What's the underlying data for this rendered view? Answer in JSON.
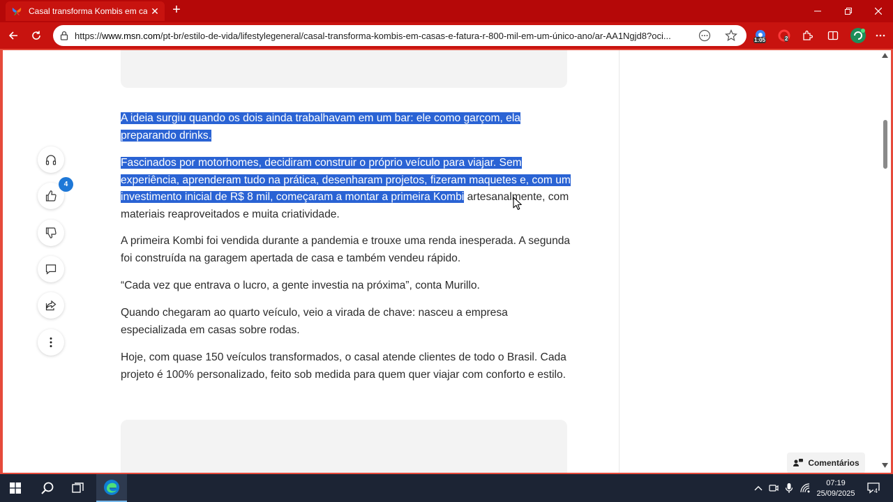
{
  "browser": {
    "tab_title": "Casal transforma Kombis em casas",
    "url_prefix": "https://",
    "url_domain": "www.msn.com",
    "url_path": "/pt-br/estilo-de-vida/lifestylegeneral/casal-transforma-kombis-em-casas-e-fatura-r-800-mil-em-um-único-ano/ar-AA1Ngjd8?oci...",
    "extension_badge_1": "1:05",
    "extension_badge_2": "2",
    "accent_color": "#c8130f"
  },
  "article": {
    "paragraphs": {
      "p1": "A ideia surgiu quando os dois ainda trabalhavam em um bar: ele como garçom, ela preparando drinks.",
      "p2_selected": "Fascinados por motorhomes, decidiram construir o próprio veículo para viajar. Sem experiência, aprenderam tudo na prática, desenharam projetos, fizeram maquetes e, com um investimento inicial de R$ 8 mil, começaram a montar a primeira Kombi",
      "p2_rest": "artesanalmente, com materiais reaproveitados e muita criatividade.",
      "p3": "A primeira Kombi foi vendida durante a pandemia e trouxe uma renda inesperada. A segunda foi construída na garagem apertada de casa e também vendeu rápido.",
      "p4": "“Cada vez que entrava o lucro, a gente investia na próxima”, conta Murillo.",
      "p5": "Quando chegaram ao quarto veículo, veio a virada de chave: nasceu a empresa especializada em casas sobre rodas.",
      "p6": "Hoje, com quase 150 veículos transformados, o casal atende clientes de todo o Brasil. Cada projeto é 100% personalizado, feito sob medida para quem quer viajar com conforto e estilo."
    },
    "selection_color": "#2a63d4"
  },
  "side_actions": {
    "like_count": "4",
    "icons": [
      "headphones-icon",
      "thumbs-up-icon",
      "thumbs-down-icon",
      "comment-icon",
      "share-icon",
      "more-icon"
    ]
  },
  "comments_button": "Comentários",
  "taskbar": {
    "time": "07:19",
    "date": "25/09/2025",
    "notification_count": "4"
  }
}
